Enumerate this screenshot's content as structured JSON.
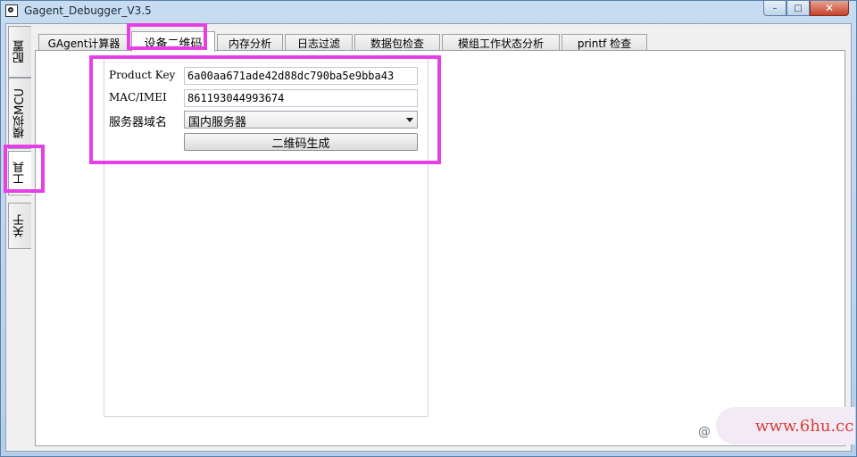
{
  "window": {
    "title": "Gagent_Debugger_V3.5",
    "minimize": "–",
    "maximize": "□",
    "close": "✕"
  },
  "side_tabs": [
    "配置",
    "模拟MCU",
    "工具",
    "关于"
  ],
  "tabs": [
    "GAgent计算器",
    "设备二维码",
    "内存分析",
    "日志过滤",
    "数据包检查",
    "模组工作状态分析",
    "printf 检查"
  ],
  "active_tab": "设备二维码",
  "form": {
    "product_key_label": "Product Key",
    "product_key_value": "6a00aa671ade42d88dc790ba5e9bba43",
    "mac_label": "MAC/IMEI",
    "mac_value": "861193044993674",
    "server_label": "服务器域名",
    "server_value": "国内服务器",
    "generate_button": "二维码生成"
  },
  "watermark": {
    "at": "@",
    "text": "www.6hu.cc"
  },
  "colors": {
    "highlight": "#e63fe6",
    "watermark_text": "#d8403a"
  }
}
